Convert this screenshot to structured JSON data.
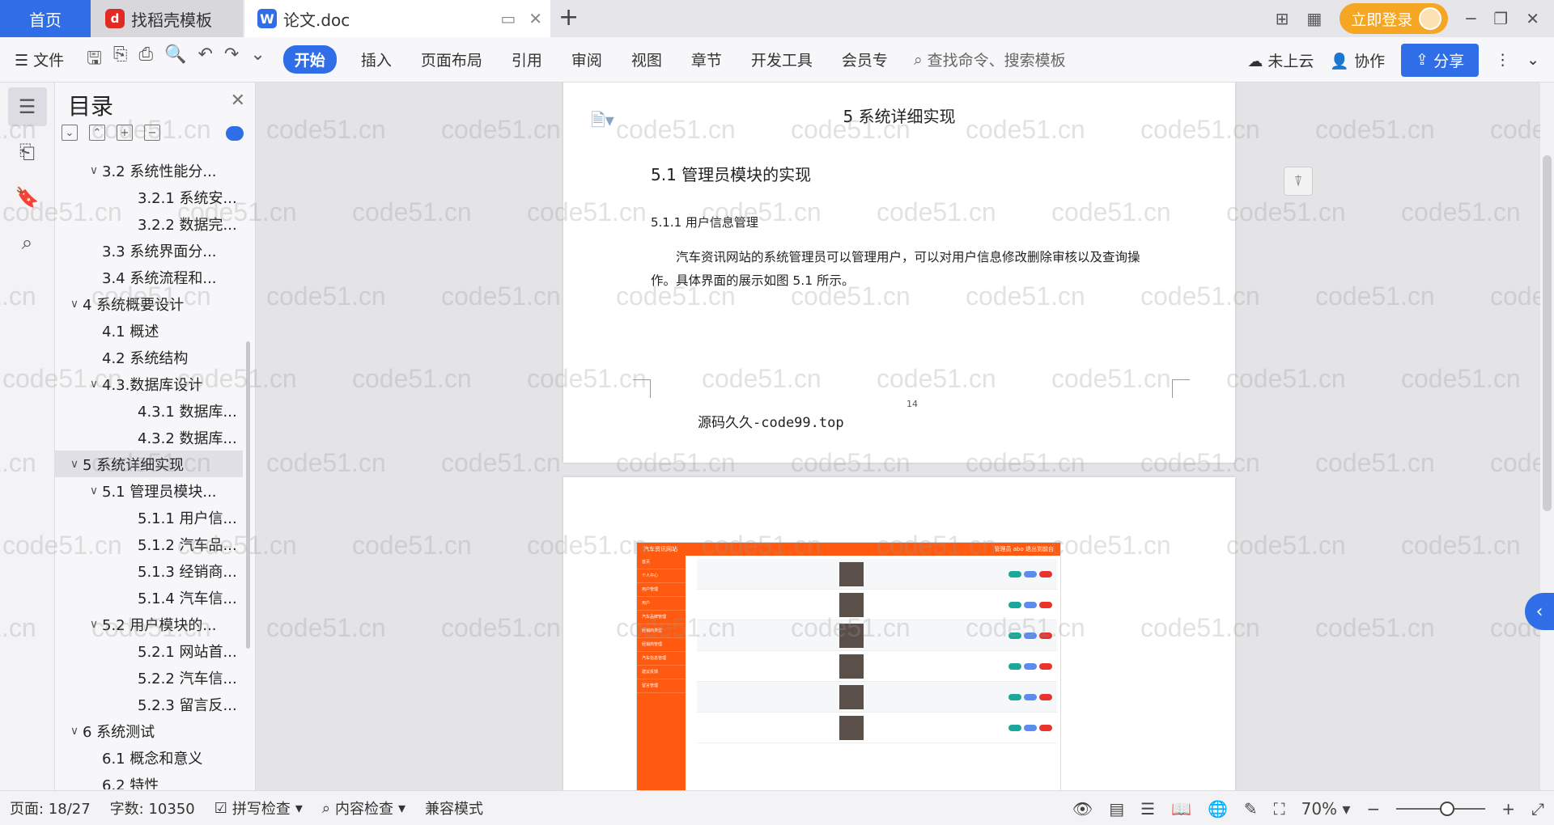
{
  "tabs": {
    "home": "首页",
    "template": "找稻壳模板",
    "document": "论文.doc"
  },
  "titlebar": {
    "login": "立即登录"
  },
  "ribbon": {
    "file": "文件",
    "tabs": [
      "开始",
      "插入",
      "页面布局",
      "引用",
      "审阅",
      "视图",
      "章节",
      "开发工具",
      "会员专"
    ],
    "search_placeholder": "查找命令、搜索模板",
    "cloud": "未上云",
    "collab": "协作",
    "share": "分享"
  },
  "toc": {
    "title": "目录",
    "items": [
      {
        "level": 2,
        "arrow": "∨",
        "label": "3.2 系统性能分..."
      },
      {
        "level": 3,
        "arrow": "",
        "label": "3.2.1 系统安..."
      },
      {
        "level": 3,
        "arrow": "",
        "label": "3.2.2 数据完..."
      },
      {
        "level": 2,
        "arrow": "",
        "label": "3.3 系统界面分..."
      },
      {
        "level": 2,
        "arrow": "",
        "label": "3.4 系统流程和..."
      },
      {
        "level": 1,
        "arrow": "∨",
        "label": "4 系统概要设计"
      },
      {
        "level": 2,
        "arrow": "",
        "label": "4.1 概述"
      },
      {
        "level": 2,
        "arrow": "",
        "label": "4.2 系统结构"
      },
      {
        "level": 2,
        "arrow": "∨",
        "label": "4.3.数据库设计"
      },
      {
        "level": 3,
        "arrow": "",
        "label": "4.3.1 数据库..."
      },
      {
        "level": 3,
        "arrow": "",
        "label": "4.3.2 数据库..."
      },
      {
        "level": 1,
        "arrow": "∨",
        "label": "5 系统详细实现",
        "selected": true
      },
      {
        "level": 2,
        "arrow": "∨",
        "label": "5.1  管理员模块..."
      },
      {
        "level": 3,
        "arrow": "",
        "label": "5.1.1  用户信..."
      },
      {
        "level": 3,
        "arrow": "",
        "label": "5.1.2  汽车品..."
      },
      {
        "level": 3,
        "arrow": "",
        "label": "5.1.3  经销商..."
      },
      {
        "level": 3,
        "arrow": "",
        "label": "5.1.4  汽车信..."
      },
      {
        "level": 2,
        "arrow": "∨",
        "label": "5.2  用户模块的..."
      },
      {
        "level": 3,
        "arrow": "",
        "label": "5.2.1  网站首..."
      },
      {
        "level": 3,
        "arrow": "",
        "label": "5.2.2  汽车信..."
      },
      {
        "level": 3,
        "arrow": "",
        "label": "5.2.3  留言反..."
      },
      {
        "level": 1,
        "arrow": "∨",
        "label": "6 系统测试"
      },
      {
        "level": 2,
        "arrow": "",
        "label": "6.1 概念和意义"
      },
      {
        "level": 2,
        "arrow": "",
        "label": "6.2 特性"
      }
    ]
  },
  "page": {
    "running_head": "5 系统详细实现",
    "heading2": "5.1  管理员模块的实现",
    "heading3": "5.1.1  用户信息管理",
    "paragraph": "汽车资讯网站的系统管理员可以管理用户，可以对用户信息修改删除审核以及查询操作。具体界面的展示如图 5.1 所示。",
    "page_number": "14",
    "footer": "源码久久-code99.top"
  },
  "embedded_screenshot": {
    "site_title": "汽车资讯网站",
    "header_right": "管理员 abo    退出到前台",
    "menu": [
      "首页",
      "个人中心",
      "用户管理",
      "用户",
      "汽车品牌管理",
      "经销商类型",
      "经销商管理",
      "汽车信息管理",
      "建议反馈",
      "留言管理"
    ],
    "row_count": 6
  },
  "watermark": "code51.cn",
  "status": {
    "page": "页面: 18/27",
    "words": "字数: 10350",
    "spell": "拼写检查",
    "content": "内容检查",
    "compat": "兼容模式",
    "zoom": "70%"
  },
  "colors": {
    "accent": "#2f6ee6",
    "login": "#f5a623",
    "site_orange": "#ff5a10"
  }
}
